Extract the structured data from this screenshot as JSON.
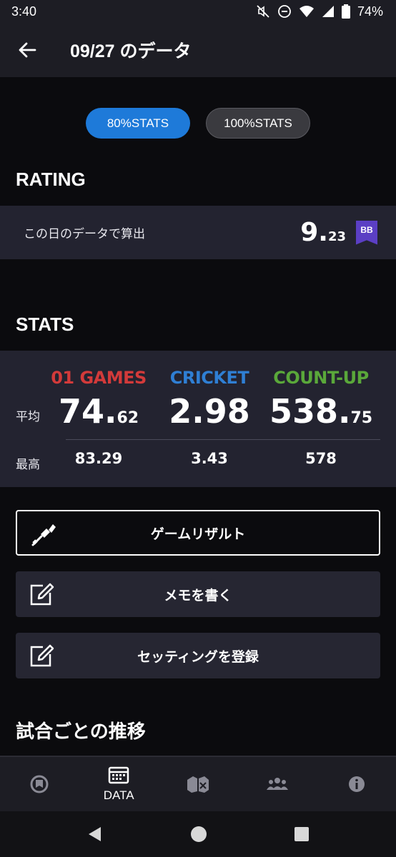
{
  "status_bar": {
    "time": "3:40",
    "battery": "74%"
  },
  "header": {
    "title": "09/27 のデータ"
  },
  "toggle": {
    "option_80": "80%STATS",
    "option_100": "100%STATS",
    "selected": "80%STATS"
  },
  "rating": {
    "section_title": "RATING",
    "label": "この日のデータで算出",
    "value_int": "9.",
    "value_dec": "23",
    "badge": "BB",
    "badge_color": "#5b3fc4"
  },
  "stats": {
    "section_title": "STATS",
    "row_avg_label": "平均",
    "row_max_label": "最高",
    "columns": [
      {
        "name": "01 GAMES",
        "color": "#d33a3a",
        "avg_int": "74.",
        "avg_dec": "62",
        "max": "83.29"
      },
      {
        "name": "CRICKET",
        "color": "#2f7fd4",
        "avg_int": "2.98",
        "avg_dec": "",
        "max": "3.43"
      },
      {
        "name": "COUNT-UP",
        "color": "#5aa83a",
        "avg_int": "538.",
        "avg_dec": "75",
        "max": "578"
      }
    ]
  },
  "actions": {
    "game_result": "ゲームリザルト",
    "write_memo": "メモを書く",
    "register_setting": "セッティングを登録"
  },
  "trend": {
    "section_title": "試合ごとの推移"
  },
  "bottom_nav": {
    "data_label": "DATA"
  },
  "accent_color": "#1e7ad9"
}
